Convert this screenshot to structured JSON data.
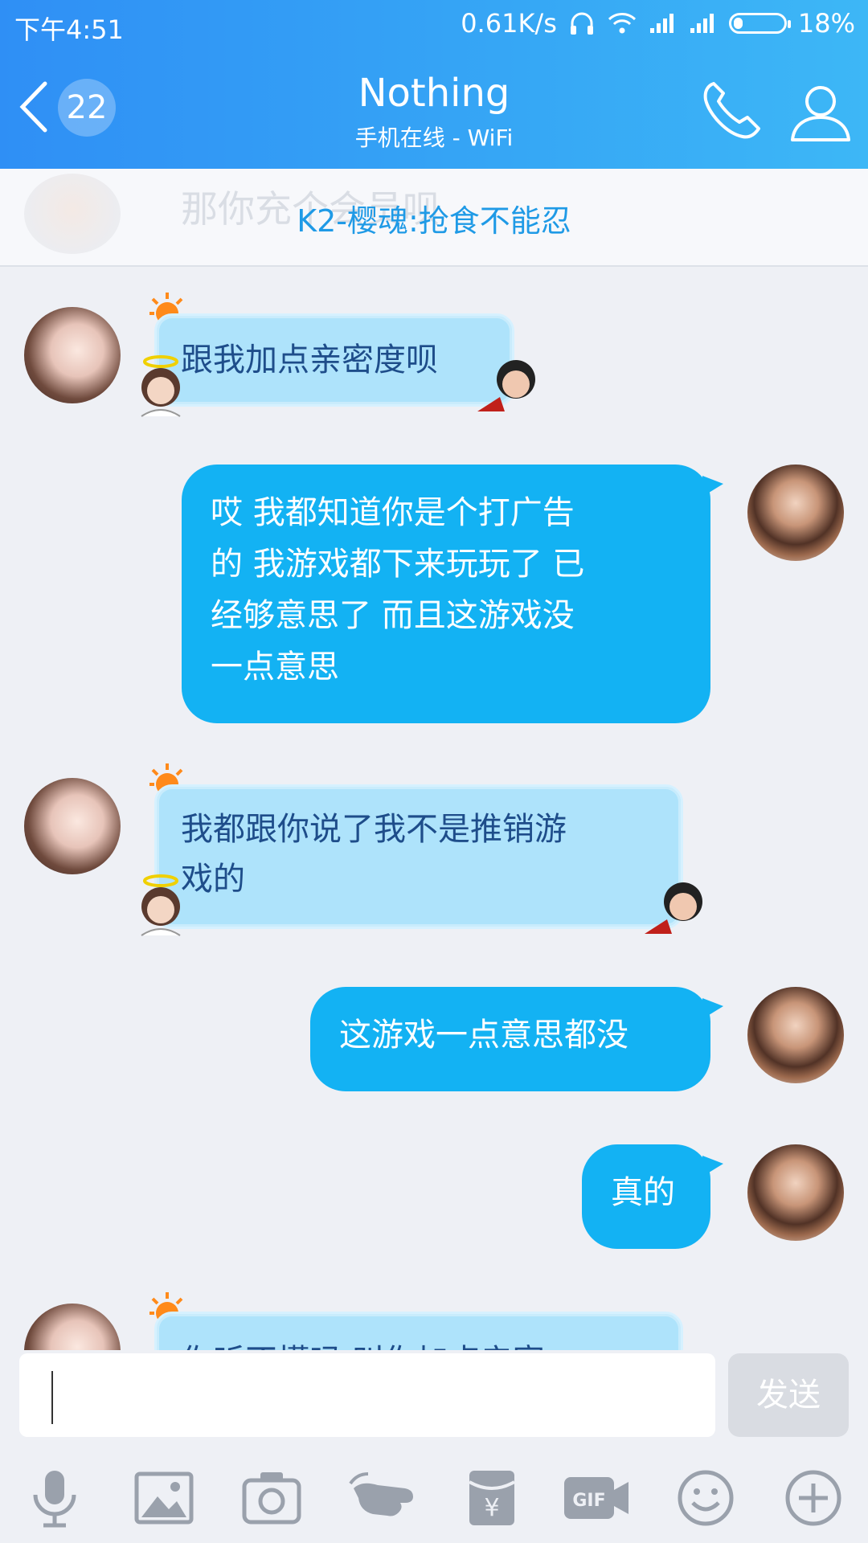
{
  "status_bar": {
    "time": "下午4:51",
    "speed": "0.61K/s",
    "battery_pct": "18%",
    "battery_level": 0.18
  },
  "header": {
    "unread_count": "22",
    "title": "Nothing",
    "subtitle": "手机在线 - WiFi",
    "back_icon": "back-chevron-icon",
    "phone_icon": "phone-icon",
    "profile_icon": "profile-icon"
  },
  "banner": {
    "ghost_text": "那你充个会员呗",
    "text": "K2-樱魂:抢食不能忍"
  },
  "messages": [
    {
      "from": "her",
      "text": "跟我加点亲密度呗"
    },
    {
      "from": "me",
      "lines": [
        "哎  我都知道你是个打广告",
        "的  我游戏都下来玩玩了  已",
        "经够意思了  而且这游戏没",
        "一点意思"
      ]
    },
    {
      "from": "her",
      "lines": [
        "我都跟你说了我不是推销游",
        "戏的"
      ]
    },
    {
      "from": "me",
      "text": "这游戏一点意思都没"
    },
    {
      "from": "me",
      "text": "真的"
    },
    {
      "from": "her",
      "text": "你听不懂吗  叫你加点亲密"
    }
  ],
  "input": {
    "placeholder": "",
    "send_label": "发送"
  },
  "toolbar": [
    "microphone-icon",
    "image-icon",
    "camera-icon",
    "poke-icon",
    "red-packet-icon",
    "gif-icon",
    "emoji-icon",
    "plus-icon"
  ],
  "colors": {
    "header_start": "#2f8ff5",
    "header_end": "#3db7f6",
    "my_bubble": "#13b2f3",
    "her_bubble": "#aee3fb",
    "banner_text": "#1f9ae6"
  }
}
